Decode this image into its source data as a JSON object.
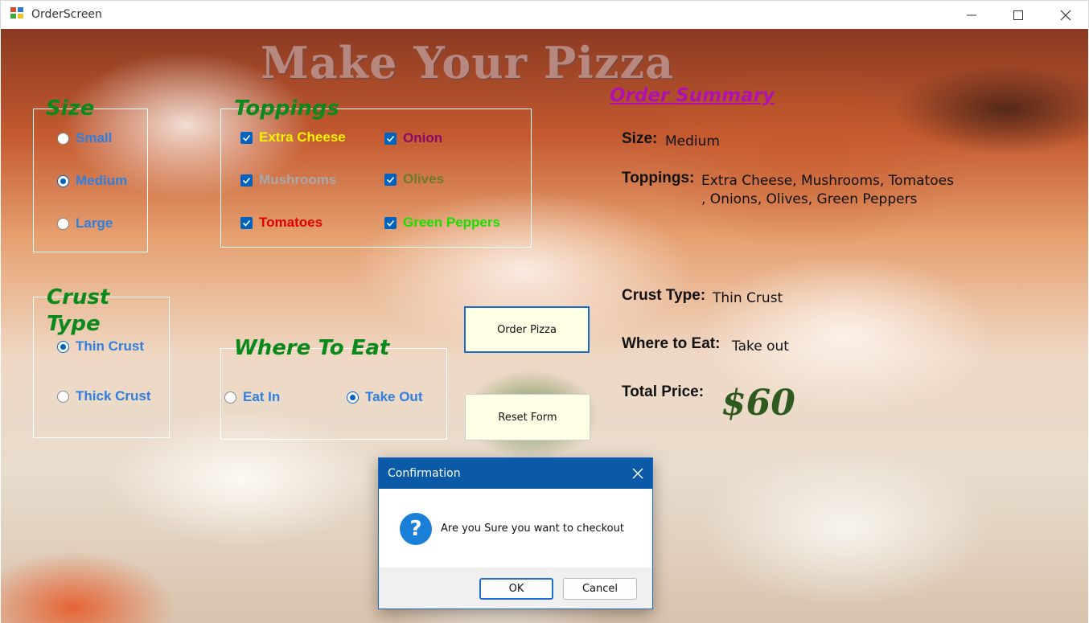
{
  "window": {
    "title": "OrderScreen"
  },
  "form": {
    "heading": "Make Your Pizza",
    "size": {
      "legend": "Size",
      "options": [
        {
          "label": "Small",
          "selected": false,
          "color": "#2f7fe0"
        },
        {
          "label": "Medium",
          "selected": true,
          "color": "#2f7fe0"
        },
        {
          "label": "Large",
          "selected": false,
          "color": "#2f7fe0"
        }
      ]
    },
    "toppings": {
      "legend": "Toppings",
      "options": [
        {
          "label": "Extra Cheese",
          "checked": true,
          "color": "#f6f300"
        },
        {
          "label": "Onion",
          "checked": true,
          "color": "#8a0a6a"
        },
        {
          "label": "Mushrooms",
          "checked": true,
          "color": "#a8a8a8"
        },
        {
          "label": "Olives",
          "checked": true,
          "color": "#6f7a2a"
        },
        {
          "label": "Tomatoes",
          "checked": true,
          "color": "#e10000"
        },
        {
          "label": "Green Peppers",
          "checked": true,
          "color": "#18e000"
        }
      ]
    },
    "crust": {
      "legend_line1": "Crust",
      "legend_line2": "Type",
      "options": [
        {
          "label": "Thin Crust",
          "selected": true,
          "color": "#2f7fe0"
        },
        {
          "label": "Thick Crust",
          "selected": false,
          "color": "#2f7fe0"
        }
      ]
    },
    "where": {
      "legend": "Where To Eat",
      "options": [
        {
          "label": "Eat In",
          "selected": false,
          "color": "#2f7fe0"
        },
        {
          "label": "Take Out",
          "selected": true,
          "color": "#2f7fe0"
        }
      ]
    },
    "buttons": {
      "order": "Order Pizza",
      "reset": "Reset Form"
    }
  },
  "summary": {
    "title": "Order Summary",
    "size_label": "Size:",
    "size_value": "Medium",
    "toppings_label": "Toppings:",
    "toppings_line1": "Extra Cheese, Mushrooms, Tomatoes",
    "toppings_line2": ", Onions, Olives, Green Peppers",
    "crust_label": "Crust Type:",
    "crust_value": "Thin Crust",
    "where_label": "Where to Eat:",
    "where_value": "Take out",
    "price_label": "Total Price:",
    "price_value": "$60"
  },
  "dialog": {
    "title": "Confirmation",
    "icon": "question-icon",
    "message": "Are you Sure you want to checkout",
    "ok_label": "OK",
    "cancel_label": "Cancel"
  }
}
